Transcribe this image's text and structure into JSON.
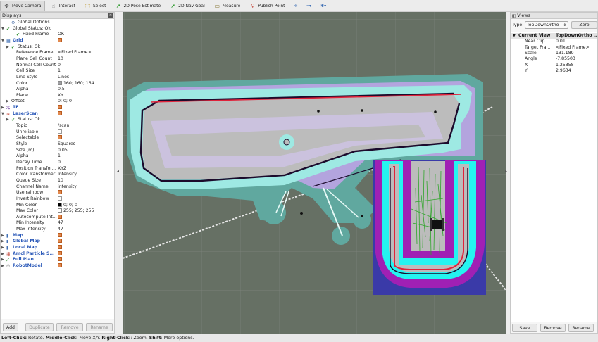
{
  "toolbar": {
    "items": [
      {
        "label": "Move Camera",
        "icon": "move-camera-icon"
      },
      {
        "label": "Interact",
        "icon": "interact-icon"
      },
      {
        "label": "Select",
        "icon": "select-icon"
      },
      {
        "label": "2D Pose Estimate",
        "icon": "pose-arrow-icon"
      },
      {
        "label": "2D Nav Goal",
        "icon": "goal-arrow-icon"
      },
      {
        "label": "Measure",
        "icon": "ruler-icon"
      },
      {
        "label": "Publish Point",
        "icon": "pin-icon"
      }
    ],
    "extra_icons": [
      "crosshair-icon",
      "minus-dropdown-icon",
      "camera-type-dropdown-icon"
    ]
  },
  "displays": {
    "title": "Displays",
    "rows": [
      {
        "name": "Global Options",
        "value": "",
        "indent": 1,
        "cat": false,
        "icon": "gear"
      },
      {
        "name": "Global Status: Ok",
        "value": "",
        "indent": 0,
        "cat": false,
        "icon": "check",
        "arrow": "▼"
      },
      {
        "name": "Fixed Frame",
        "value": "OK",
        "indent": 2,
        "cat": false,
        "icon": "check"
      },
      {
        "name": "Grid",
        "value": "",
        "indent": 0,
        "cat": true,
        "icon": "grid",
        "arrow": "▼",
        "check": true
      },
      {
        "name": "Status: Ok",
        "value": "",
        "indent": 1,
        "cat": false,
        "icon": "check",
        "arrow": "▶"
      },
      {
        "name": "Reference Frame",
        "value": "<Fixed Frame>",
        "indent": 2,
        "cat": false
      },
      {
        "name": "Plane Cell Count",
        "value": "10",
        "indent": 2,
        "cat": false
      },
      {
        "name": "Normal Cell Count",
        "value": "0",
        "indent": 2,
        "cat": false
      },
      {
        "name": "Cell Size",
        "value": "1",
        "indent": 2,
        "cat": false
      },
      {
        "name": "Line Style",
        "value": "Lines",
        "indent": 2,
        "cat": false
      },
      {
        "name": "Color",
        "value": "160; 160; 164",
        "indent": 2,
        "cat": false,
        "swatch": "#a0a0a4"
      },
      {
        "name": "Alpha",
        "value": "0.5",
        "indent": 2,
        "cat": false
      },
      {
        "name": "Plane",
        "value": "XY",
        "indent": 2,
        "cat": false
      },
      {
        "name": "Offset",
        "value": "0; 0; 0",
        "indent": 1,
        "cat": false,
        "arrow": "▶"
      },
      {
        "name": "TF",
        "value": "",
        "indent": 0,
        "cat": true,
        "icon": "tf",
        "arrow": "▶",
        "check": true
      },
      {
        "name": "LaserScan",
        "value": "",
        "indent": 0,
        "cat": true,
        "icon": "laser",
        "arrow": "▼",
        "check": true
      },
      {
        "name": "Status: Ok",
        "value": "",
        "indent": 1,
        "cat": false,
        "icon": "check",
        "arrow": "▶"
      },
      {
        "name": "Topic",
        "value": "/scan",
        "indent": 2,
        "cat": false
      },
      {
        "name": "Unreliable",
        "value": "",
        "indent": 2,
        "cat": false,
        "check": false
      },
      {
        "name": "Selectable",
        "value": "",
        "indent": 2,
        "cat": false,
        "check": true
      },
      {
        "name": "Style",
        "value": "Squares",
        "indent": 2,
        "cat": false
      },
      {
        "name": "Size (m)",
        "value": "0.05",
        "indent": 2,
        "cat": false
      },
      {
        "name": "Alpha",
        "value": "1",
        "indent": 2,
        "cat": false
      },
      {
        "name": "Decay Time",
        "value": "0",
        "indent": 2,
        "cat": false
      },
      {
        "name": "Position Transfor...",
        "value": "XYZ",
        "indent": 2,
        "cat": false
      },
      {
        "name": "Color Transformer",
        "value": "Intensity",
        "indent": 2,
        "cat": false
      },
      {
        "name": "Queue Size",
        "value": "10",
        "indent": 2,
        "cat": false
      },
      {
        "name": "Channel Name",
        "value": "intensity",
        "indent": 2,
        "cat": false
      },
      {
        "name": "Use rainbow",
        "value": "",
        "indent": 2,
        "cat": false,
        "check": true
      },
      {
        "name": "Invert Rainbow",
        "value": "",
        "indent": 2,
        "cat": false,
        "check": false
      },
      {
        "name": "Min Color",
        "value": "0; 0; 0",
        "indent": 2,
        "cat": false,
        "swatch": "#000000"
      },
      {
        "name": "Max Color",
        "value": "255; 255; 255",
        "indent": 2,
        "cat": false,
        "swatch": "#ffffff"
      },
      {
        "name": "Autocompute Int...",
        "value": "",
        "indent": 2,
        "cat": false,
        "check": true
      },
      {
        "name": "Min Intensity",
        "value": "47",
        "indent": 2,
        "cat": false
      },
      {
        "name": "Max Intensity",
        "value": "47",
        "indent": 2,
        "cat": false
      },
      {
        "name": "Map",
        "value": "",
        "indent": 0,
        "cat": true,
        "icon": "map",
        "arrow": "▶",
        "check": true
      },
      {
        "name": "Global Map",
        "value": "",
        "indent": 0,
        "cat": true,
        "icon": "folder",
        "arrow": "▶",
        "check": true
      },
      {
        "name": "Local Map",
        "value": "",
        "indent": 0,
        "cat": true,
        "icon": "folder",
        "arrow": "▶",
        "check": true
      },
      {
        "name": "Amcl Particle S...",
        "value": "",
        "indent": 0,
        "cat": true,
        "icon": "particles",
        "arrow": "▶",
        "check": true
      },
      {
        "name": "Full Plan",
        "value": "",
        "indent": 0,
        "cat": true,
        "icon": "path",
        "arrow": "▶",
        "check": true
      },
      {
        "name": "RobotModel",
        "value": "",
        "indent": 0,
        "cat": true,
        "icon": "robot",
        "arrow": "▶",
        "check": true
      }
    ],
    "buttons": [
      "Add",
      "Duplicate",
      "Remove",
      "Rename"
    ]
  },
  "views": {
    "title": "Views",
    "type_label": "Type:",
    "type_value": "TopDownOrtho",
    "zero_label": "Zero",
    "rows": [
      {
        "name": "Current View",
        "value": "TopDownOrtho ...",
        "header": true
      },
      {
        "name": "Near Clip ...",
        "value": "0.01"
      },
      {
        "name": "Target Fra...",
        "value": "<Fixed Frame>"
      },
      {
        "name": "Scale",
        "value": "131.189"
      },
      {
        "name": "Angle",
        "value": "-7.85503"
      },
      {
        "name": "X",
        "value": "1.25358"
      },
      {
        "name": "Y",
        "value": "2.9634"
      }
    ],
    "buttons": [
      "Save",
      "Remove",
      "Rename"
    ]
  },
  "status_bar": {
    "parts": [
      {
        "text": "Left-Click:",
        "bold": true
      },
      {
        "text": " Rotate. ",
        "bold": false
      },
      {
        "text": "Middle-Click:",
        "bold": true
      },
      {
        "text": " Move X/Y. ",
        "bold": false
      },
      {
        "text": "Right-Click:",
        "bold": true
      },
      {
        "text": ": Zoom. ",
        "bold": false
      },
      {
        "text": "Shift",
        "bold": true
      },
      {
        "text": ": More options.",
        "bold": false
      }
    ]
  },
  "colors": {
    "map_background": "#667064",
    "free_space": "#bcbcbc",
    "costmap_cyan": "#9ee9e3",
    "costmap_teal": "#60a89f",
    "inflation_lavender": "#b3a4de",
    "obstacle": "#1c0b2c",
    "local_magenta": "#a020b4",
    "local_blue": "#3a3aa8",
    "local_cyan": "#25f4f0",
    "plan_red": "#e0223a",
    "particles_green": "#2fa52a",
    "laser_white": "#f2f2f2",
    "check_orange": "#e2894e"
  }
}
